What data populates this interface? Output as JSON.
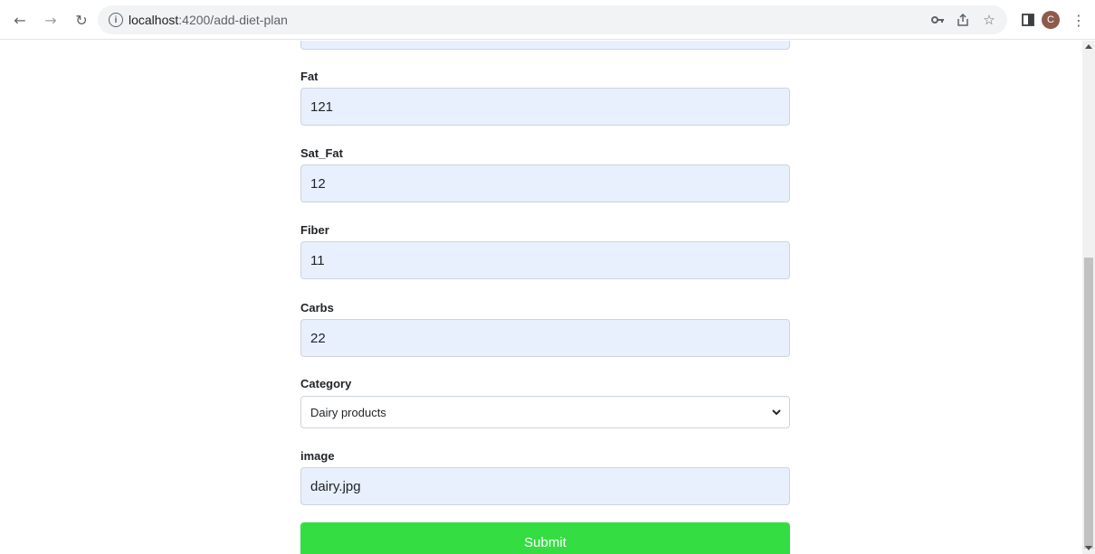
{
  "browser": {
    "url_host": "localhost",
    "url_rest": ":4200/add-diet-plan",
    "avatar_letter": "C",
    "icons": [
      "back-arrow-icon",
      "forward-arrow-icon",
      "reload-icon",
      "info-icon",
      "key-icon",
      "share-icon",
      "star-icon",
      "sidepanel-icon",
      "avatar",
      "kebab-menu-icon"
    ]
  },
  "form": {
    "fields": [
      {
        "label": "Fat",
        "value": "121"
      },
      {
        "label": "Sat_Fat",
        "value": "12"
      },
      {
        "label": "Fiber",
        "value": "11"
      },
      {
        "label": "Carbs",
        "value": "22"
      }
    ],
    "category": {
      "label": "Category",
      "selected": "Dairy products"
    },
    "image": {
      "label": "image",
      "value": "dairy.jpg"
    },
    "submit_label": "Submit"
  },
  "colors": {
    "input_bg": "#e8f0fe",
    "submit_bg": "#34dd42"
  }
}
